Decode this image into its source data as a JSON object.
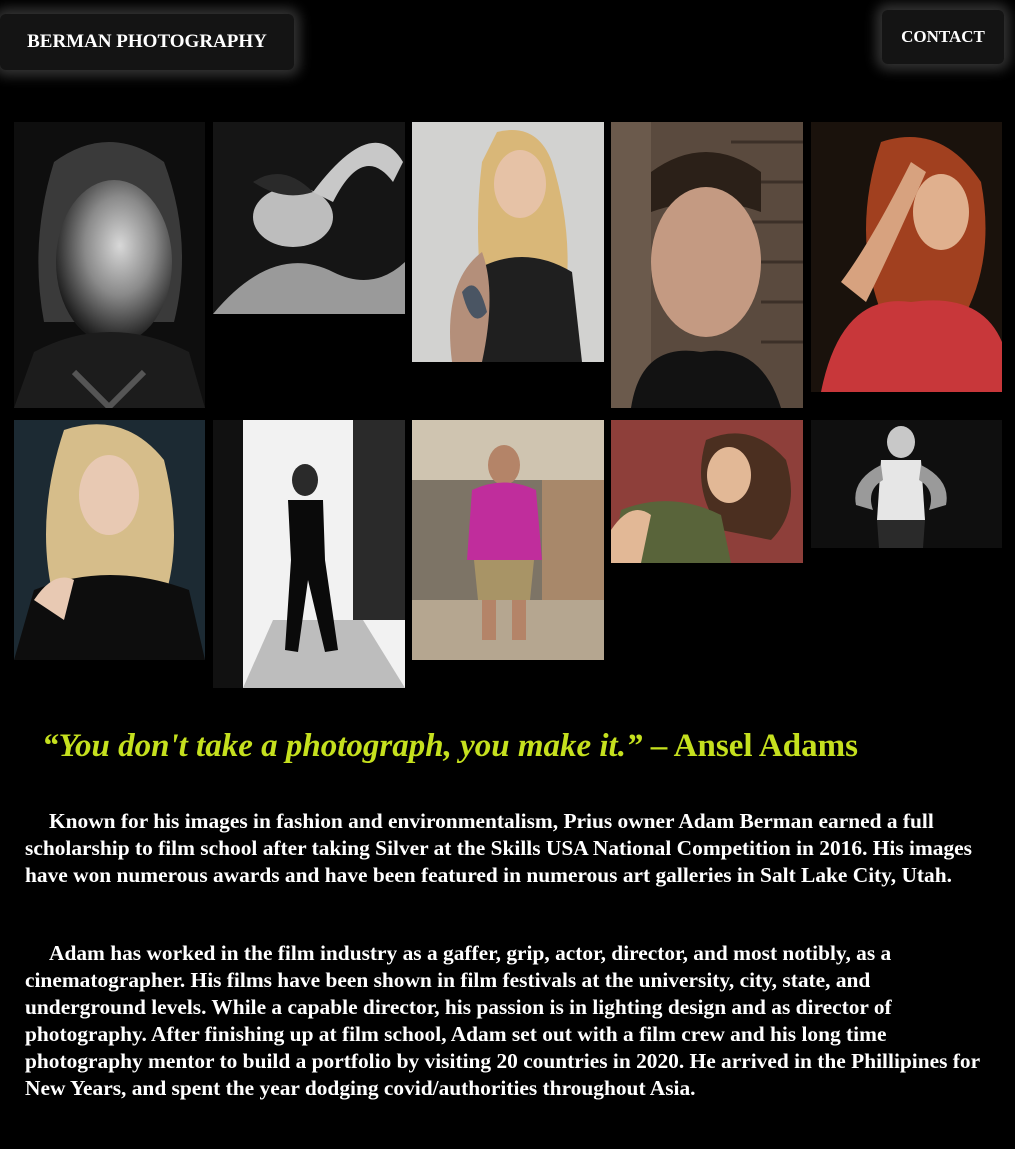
{
  "header": {
    "site_title": "BERMAN PHOTOGRAPHY",
    "contact_label": "CONTACT"
  },
  "gallery": {
    "photos": [
      {
        "name": "photo-woman-ponytail-bw",
        "tone": "bw"
      },
      {
        "name": "photo-woman-reclining-bw",
        "tone": "bw"
      },
      {
        "name": "photo-woman-tattoo-blonde",
        "tone": "color"
      },
      {
        "name": "photo-man-brick-wall",
        "tone": "color"
      },
      {
        "name": "photo-redhead-red-top",
        "tone": "color"
      },
      {
        "name": "photo-blonde-black-dress",
        "tone": "color"
      },
      {
        "name": "photo-woman-hallway-bw",
        "tone": "bw"
      },
      {
        "name": "photo-man-runway-pink-shirt",
        "tone": "color"
      },
      {
        "name": "photo-woman-green-top",
        "tone": "color"
      },
      {
        "name": "photo-woman-hands-hips-bw",
        "tone": "bw"
      }
    ]
  },
  "quote": {
    "text": "“You don't take a photograph, you make it.”",
    "attribution": " – Ansel Adams"
  },
  "bio": {
    "paragraph_1": "Known for his images in fashion and environmentalism, Prius owner Adam Berman earned a full scholarship to film school after taking Silver at the Skills USA National Competition in 2016. His images have won numerous awards and have been featured in numerous art galleries in Salt Lake City, Utah.",
    "paragraph_2": "Adam has worked in the film industry as a gaffer, grip, actor, director, and most notibly, as a cinematographer. His films have been shown in film festivals at the university, city, state, and underground levels. While a capable director, his passion is in lighting design and as director of photography. After finishing up at film school, Adam set out with a film crew and his long time photography mentor to build a portfolio by visiting 20 countries in 2020. He arrived in the Phillipines for New Years, and spent the year dodging covid/authorities throughout Asia."
  },
  "colors": {
    "background": "#000000",
    "quote_accent": "#c5e01e",
    "text": "#ffffff"
  }
}
